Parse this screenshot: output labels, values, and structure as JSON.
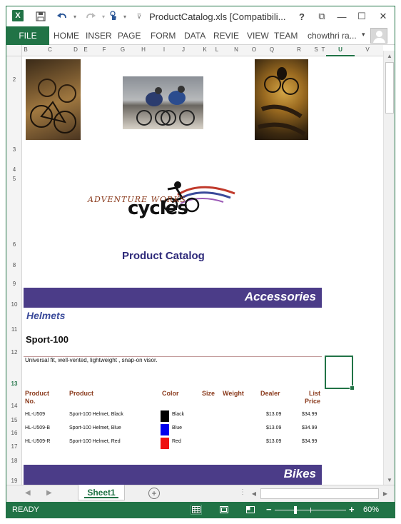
{
  "window": {
    "title": "ProductCatalog.xls  [Compatibili...",
    "help": "?",
    "restore_ribbon": "⧉",
    "minimize": "—",
    "maximize": "☐",
    "close": "✕"
  },
  "quick_access": {
    "app_icon": "X",
    "save_icon": "floppy-disk",
    "undo_icon": "undo",
    "redo_icon": "redo",
    "touch_icon": "touch-mode",
    "customize_icon": "customize"
  },
  "ribbon": {
    "file": "FILE",
    "tabs": [
      "HOME",
      "INSER",
      "PAGE",
      "FORM",
      "DATA",
      "REVIE",
      "VIEW",
      "TEAM"
    ],
    "user": "chowthri ra...",
    "user_dropdown": "▾"
  },
  "columns": [
    "B",
    "C",
    "D",
    "E",
    "F",
    "G",
    "H",
    "I",
    "J",
    "K",
    "L",
    "N",
    "O",
    "Q",
    "R",
    "S",
    "T",
    "U",
    "V"
  ],
  "selected_column": "U",
  "rows": [
    "2",
    "3",
    "4",
    "5",
    "6",
    "8",
    "9",
    "10",
    "11",
    "12",
    "13",
    "14",
    "15",
    "16",
    "17",
    "18",
    "19"
  ],
  "selected_row": "13",
  "sheet": {
    "title": "Product Catalog",
    "logo_line1": "ADVENTURE WORKS",
    "logo_line2": "cycles",
    "section_accessories": "Accessories",
    "subsection": "Helmets",
    "product_name": "Sport-100",
    "description": "Universal fit, well-vented, lightweight , snap-on visor.",
    "section_bikes": "Bikes"
  },
  "table": {
    "headers": {
      "product_no": [
        "Product",
        "No."
      ],
      "product": "Product",
      "color": "Color",
      "size": "Size",
      "weight": "Weight",
      "dealer": "Dealer",
      "list_price": [
        "List",
        "Price"
      ]
    },
    "rows": [
      {
        "no": "HL-U509",
        "product": "Sport-100 Helmet, Black",
        "color": "Black",
        "swatch": "#000000",
        "dealer": "$13.09",
        "list": "$34.99"
      },
      {
        "no": "HL-U509-B",
        "product": "Sport-100 Helmet, Blue",
        "color": "Blue",
        "swatch": "#0000ee",
        "dealer": "$13.09",
        "list": "$34.99"
      },
      {
        "no": "HL-U509-R",
        "product": "Sport-100 Helmet, Red",
        "color": "Red",
        "swatch": "#ee1111",
        "dealer": "$13.09",
        "list": "$34.99"
      }
    ]
  },
  "sheet_tabs": {
    "active": "Sheet1",
    "add": "+"
  },
  "status": {
    "ready": "READY",
    "zoom": "60%",
    "zoom_minus": "−",
    "zoom_plus": "+"
  },
  "colors": {
    "excel_green": "#217346",
    "band_purple": "#4b3c88",
    "title_navy": "#2e2a7a",
    "header_brown": "#8a3a1c"
  }
}
